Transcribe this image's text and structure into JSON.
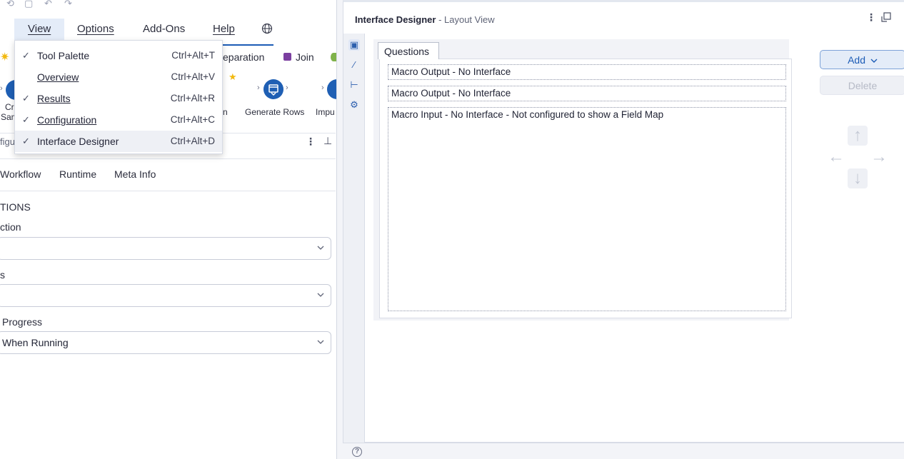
{
  "menubar": {
    "items": [
      {
        "label": "View",
        "underline": true
      },
      {
        "label": "Options",
        "underline": true
      },
      {
        "label": "Add-Ons",
        "underline": false
      },
      {
        "label": "Help",
        "underline": true
      }
    ],
    "globe_icon": "globe-icon"
  },
  "view_menu": {
    "items": [
      {
        "label": "Tool Palette",
        "shortcut": "Ctrl+Alt+T",
        "checked": true
      },
      {
        "label": "Overview",
        "shortcut": "Ctrl+Alt+V",
        "checked": false
      },
      {
        "label": "Results",
        "shortcut": "Ctrl+Alt+R",
        "checked": true
      },
      {
        "label": "Configuration",
        "shortcut": "Ctrl+Alt+C",
        "checked": true
      },
      {
        "label": "Interface Designer",
        "shortcut": "Ctrl+Alt+D",
        "checked": true
      }
    ]
  },
  "ribbon": {
    "tabs": [
      {
        "label": "eparation"
      },
      {
        "label": "Join"
      }
    ],
    "tools": [
      {
        "label": "Cre"
      },
      {
        "label": "Sam"
      },
      {
        "label": "n"
      },
      {
        "label": "Generate Rows"
      },
      {
        "label": "Impu"
      }
    ]
  },
  "config_panel": {
    "header": "figu",
    "tabs": [
      "Workflow",
      "Runtime",
      "Meta Info"
    ],
    "section": "TIONS",
    "fields": [
      {
        "label": "ction",
        "value": ""
      },
      {
        "label": "s",
        "value": ""
      },
      {
        "label": "Progress",
        "value": "When Running"
      }
    ]
  },
  "designer": {
    "title": "Interface Designer",
    "subtitle": "- Layout View",
    "tab": "Questions",
    "questions": [
      "Macro Output - No Interface",
      "Macro Output - No Interface",
      "Macro Input - No Interface - Not configured to show a Field Map"
    ],
    "add_label": "Add",
    "delete_label": "Delete",
    "help_label": "?"
  },
  "colors": {
    "accent": "#1c5cb6",
    "join_purple": "#7b3fa0",
    "star": "#f2b90f"
  }
}
